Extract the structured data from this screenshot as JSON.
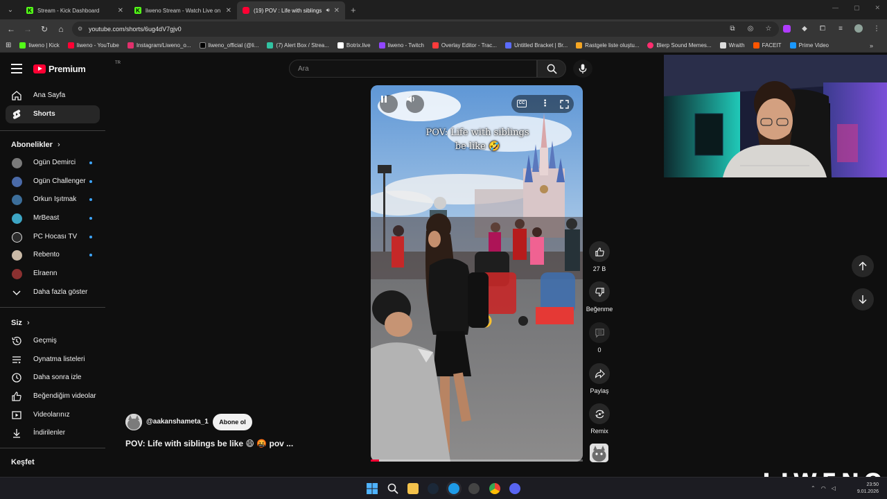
{
  "browser": {
    "tabs": [
      {
        "title": "Stream - Kick Dashboard",
        "favicon_color": "#53fc18",
        "favicon_letter": "K",
        "active": false
      },
      {
        "title": "liweno Stream - Watch Live on",
        "favicon_color": "#53fc18",
        "favicon_letter": "K",
        "active": false
      },
      {
        "title": "(19) POV : Life with siblings",
        "favicon_color": "#ff0033",
        "favicon_letter": "",
        "active": true
      }
    ],
    "url": "youtube.com/shorts/6ug4dV7gjv0",
    "bookmarks": [
      {
        "label": "liweno | Kick",
        "color": "#53fc18"
      },
      {
        "label": "liweno - YouTube",
        "color": "#ff0033"
      },
      {
        "label": "Instagram/Liweno_o...",
        "color": "#e1306c"
      },
      {
        "label": "liweno_official (@li...",
        "color": "#000000"
      },
      {
        "label": "(7) Alert Box / Strea...",
        "color": "#31c3a2"
      },
      {
        "label": "Botrix.live",
        "color": "#ffffff"
      },
      {
        "label": "liweno - Twitch",
        "color": "#9146ff"
      },
      {
        "label": "Overlay Editor - Trac...",
        "color": "#ff3b3b"
      },
      {
        "label": "Untitled Bracket | Br...",
        "color": "#5b6cff"
      },
      {
        "label": "Rastgele liste oluştu...",
        "color": "#f5a623"
      },
      {
        "label": "Blerp Sound Memes...",
        "color": "#ff2d6f"
      },
      {
        "label": "Wraith",
        "color": "#dddddd"
      },
      {
        "label": "FACEIT",
        "color": "#ff5500"
      },
      {
        "label": "Prime Video",
        "color": "#1a98ff"
      }
    ]
  },
  "youtube": {
    "logo_text": "Premium",
    "logo_region": "TR",
    "search_placeholder": "Ara",
    "sidebar": {
      "main": [
        {
          "label": "Ana Sayfa",
          "icon": "home-icon",
          "active": false
        },
        {
          "label": "Shorts",
          "icon": "shorts-icon",
          "active": true
        }
      ],
      "subscriptions_header": "Abonelikler",
      "subscriptions": [
        {
          "label": "Ogün Demirci",
          "color": "#7a7a7a"
        },
        {
          "label": "Ogün Challenger",
          "color": "#4a6aa8"
        },
        {
          "label": "Orkun Işıtmak",
          "color": "#3c6e9a"
        },
        {
          "label": "MrBeast",
          "color": "#3da5c4"
        },
        {
          "label": "PC Hocası TV",
          "color": "#2c2c2c"
        },
        {
          "label": "Rebento",
          "color": "#c9b9a6"
        },
        {
          "label": "Elraenn",
          "color": "#8a3030"
        }
      ],
      "show_more": "Daha fazla göster",
      "you_header": "Siz",
      "you_items": [
        {
          "label": "Geçmiş",
          "icon": "history-icon"
        },
        {
          "label": "Oynatma listeleri",
          "icon": "playlist-icon"
        },
        {
          "label": "Daha sonra izle",
          "icon": "clock-icon"
        },
        {
          "label": "Beğendiğim videolar",
          "icon": "like-icon"
        },
        {
          "label": "Videolarınız",
          "icon": "video-icon"
        },
        {
          "label": "İndirilenler",
          "icon": "download-icon"
        }
      ],
      "explore_header": "Keşfet"
    },
    "short": {
      "caption_line1": "POV:  Life with siblings",
      "caption_line2": "be like 🤣",
      "channel": "@aakanshameta_1",
      "subscribe": "Abone ol",
      "title": "POV:  Life with siblings be like 😄 🤬 pov ...",
      "progress": 0.04
    },
    "actions": {
      "likes": "27 B",
      "dislike": "Beğenme",
      "comments": "0",
      "share": "Paylaş",
      "remix": "Remix"
    }
  },
  "overlay": {
    "watermark": "LIWENO"
  },
  "taskbar": {
    "time": "23:50",
    "date": "9.01.2026"
  }
}
